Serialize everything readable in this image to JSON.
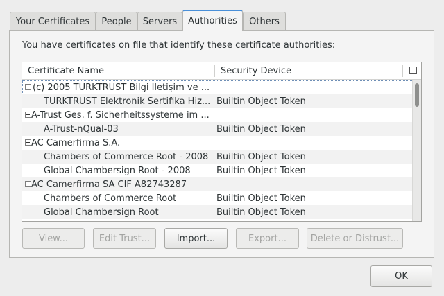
{
  "tabs": [
    {
      "label": "Your Certificates",
      "active": false
    },
    {
      "label": "People",
      "active": false
    },
    {
      "label": "Servers",
      "active": false
    },
    {
      "label": "Authorities",
      "active": true
    },
    {
      "label": "Others",
      "active": false
    }
  ],
  "intro_text": "You have certificates on file that identify these certificate authorities:",
  "columns": {
    "name": "Certificate Name",
    "device": "Security Device"
  },
  "rows": [
    {
      "type": "group",
      "name": "(c) 2005 TÜRKTRUST Bilgi İletişim ve ...",
      "device": "",
      "selected": true
    },
    {
      "type": "item",
      "name": "TÜRKTRUST Elektronik Sertifika Hiz...",
      "device": "Builtin Object Token"
    },
    {
      "type": "group",
      "name": "A-Trust Ges. f. Sicherheitssysteme im ...",
      "device": ""
    },
    {
      "type": "item",
      "name": "A-Trust-nQual-03",
      "device": "Builtin Object Token"
    },
    {
      "type": "group",
      "name": "AC Camerfirma S.A.",
      "device": ""
    },
    {
      "type": "item",
      "name": "Chambers of Commerce Root - 2008",
      "device": "Builtin Object Token"
    },
    {
      "type": "item",
      "name": "Global Chambersign Root - 2008",
      "device": "Builtin Object Token"
    },
    {
      "type": "group",
      "name": "AC Camerfirma SA CIF A82743287",
      "device": ""
    },
    {
      "type": "item",
      "name": "Chambers of Commerce Root",
      "device": "Builtin Object Token"
    },
    {
      "type": "item",
      "name": "Global Chambersign Root",
      "device": "Builtin Object Token"
    }
  ],
  "buttons": {
    "view": "View...",
    "edit_trust": "Edit Trust...",
    "import": "Import...",
    "export": "Export...",
    "delete": "Delete or Distrust..."
  },
  "ok_label": "OK",
  "icons": {
    "column_picker": "column-picker-icon",
    "expander": "collapse-minus-icon"
  }
}
